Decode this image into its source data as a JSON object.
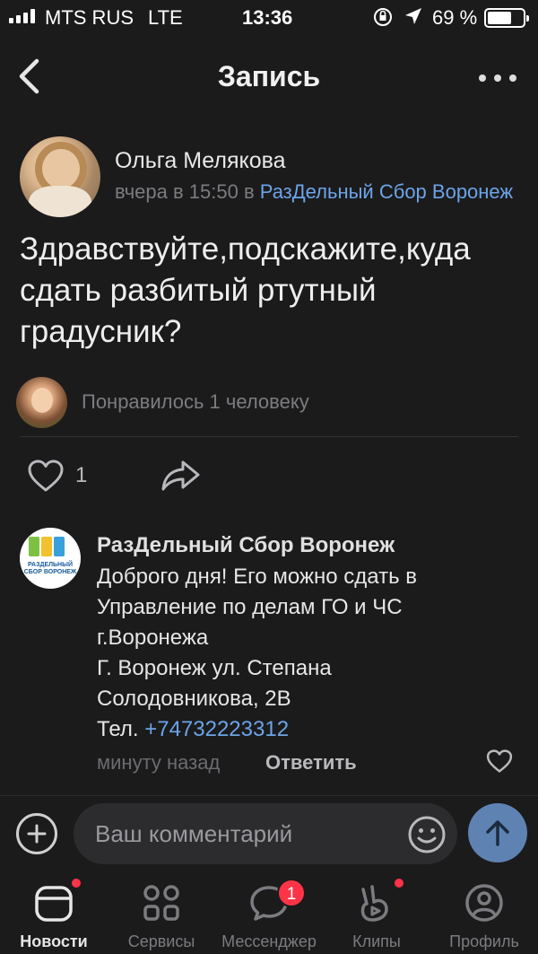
{
  "status_bar": {
    "carrier": "MTS RUS",
    "network": "LTE",
    "time": "13:36",
    "battery_percent": "69 %",
    "battery_level": 0.69
  },
  "nav": {
    "title": "Запись"
  },
  "post": {
    "author": "Ольга Мелякова",
    "meta_time": "вчера в 15:50 в ",
    "group": "РазДельный Сбор Воронеж",
    "text": "Здравствуйте,подскажите,куда сдать разбитый ртутный градусник?",
    "likes_text": "Понравилось 1 человеку",
    "like_count": "1"
  },
  "comment": {
    "author": "РазДельный Сбор Воронеж",
    "avatar_text": "РАЗДЕЛЬНЫЙ СБОР ВОРОНЕЖ",
    "lines": [
      "Доброго дня! Его можно сдать в",
      "Управление по делам ГО и ЧС",
      "г.Воронежа",
      "Г. Воронеж ул. Степана",
      "Солодовникова, 2В"
    ],
    "phone_label": "Тел. ",
    "phone": "+74732223312",
    "time": "минуту назад",
    "reply_label": "Ответить"
  },
  "composer": {
    "placeholder": "Ваш комментарий"
  },
  "tabs": [
    {
      "label": "Новости",
      "icon": "news-icon",
      "active": true
    },
    {
      "label": "Сервисы",
      "icon": "services-icon",
      "active": false
    },
    {
      "label": "Мессенджер",
      "icon": "messenger-icon",
      "active": false,
      "badge": "1"
    },
    {
      "label": "Клипы",
      "icon": "clips-icon",
      "active": false
    },
    {
      "label": "Профиль",
      "icon": "profile-icon",
      "active": false
    }
  ],
  "colors": {
    "background": "#1b1b1c",
    "link": "#6ca4e8",
    "send_button": "#5e83b3",
    "badge": "#ff3347"
  }
}
